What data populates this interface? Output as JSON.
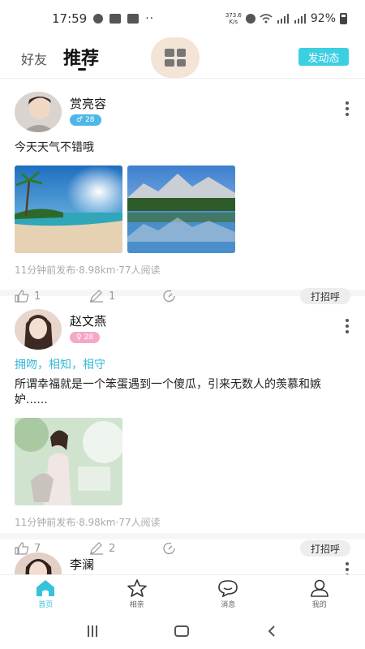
{
  "status": {
    "time": "17:59",
    "network_speed_value": "373.6",
    "network_speed_unit": "K/s",
    "battery": "92%"
  },
  "topnav": {
    "tab_friends": "好友",
    "tab_recommend": "推荐",
    "post_button": "发动态"
  },
  "posts": [
    {
      "username": "赏亮容",
      "gender": "male",
      "age": "28",
      "tagline": "",
      "text": "今天天气不错哦",
      "meta": "11分钟前发布·8.98km·77人阅读",
      "likes": "1",
      "comments": "1",
      "hello_button": "打招呼"
    },
    {
      "username": "赵文燕",
      "gender": "female",
      "age": "28",
      "tagline": "拥吻，相知，相守",
      "text": "所谓幸福就是一个笨蛋遇到一个傻瓜，引来无数人的羡慕和嫉妒......",
      "meta": "11分钟前发布·8.98km·77人阅读",
      "likes": "7",
      "comments": "2",
      "hello_button": "打招呼"
    },
    {
      "username": "李澜"
    }
  ],
  "bottomnav": {
    "home": "首页",
    "match": "相亲",
    "messages": "消息",
    "mine": "我的"
  },
  "colors": {
    "accent": "#3ccfe2",
    "tagline": "#39b7d8",
    "male_badge": "#4fb7e8",
    "female_badge": "#f5a7c7"
  }
}
